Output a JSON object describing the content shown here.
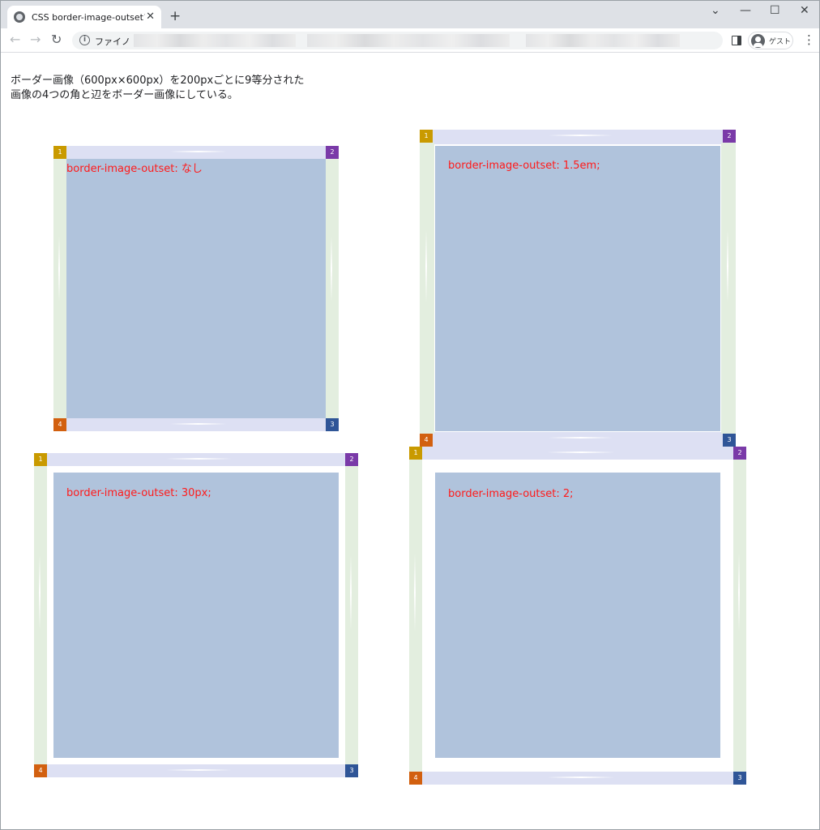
{
  "browser": {
    "tab_title": "CSS border-image-outsetプロパテ",
    "close_glyph": "✕",
    "new_tab_glyph": "+",
    "url_text": "ファイノ",
    "profile_name": "ゲスト",
    "controls": {
      "minimize": "—",
      "maximize": "☐",
      "close": "✕",
      "dropdown": "⌄"
    },
    "nav": {
      "back": "←",
      "forward": "→",
      "reload": "↻",
      "menu": "⋮",
      "info": "i"
    }
  },
  "page": {
    "intro_line1": "ボーダー画像（600px×600px）を200pxごとに9等分された",
    "intro_line2": "画像の4つの角と辺をボーダー画像にしている。",
    "boxes": [
      {
        "label": "border-image-outset: なし",
        "corners": [
          "1",
          "2",
          "3",
          "4"
        ]
      },
      {
        "label": "border-image-outset: 1.5em;",
        "corners": [
          "1",
          "2",
          "3",
          "4"
        ]
      },
      {
        "label": "border-image-outset: 30px;",
        "corners": [
          "1",
          "2",
          "3",
          "4"
        ]
      },
      {
        "label": "border-image-outset: 2;",
        "corners": [
          "1",
          "2",
          "3",
          "4"
        ]
      }
    ]
  },
  "colors": {
    "corner1": "#c99a00",
    "corner2": "#7a3aa8",
    "corner3": "#2f5597",
    "corner4": "#d2600f",
    "content_bg": "#b0c3dc",
    "label": "#ff1a1a"
  }
}
